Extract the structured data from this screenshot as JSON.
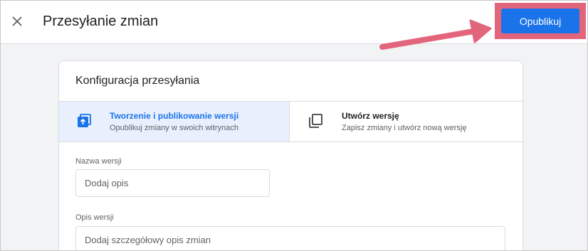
{
  "header": {
    "title": "Przesyłanie zmian",
    "publish_label": "Opublikuj",
    "close_icon": "close-icon"
  },
  "annotation": {
    "arrow_color": "#e3657c",
    "highlight_color": "#e3657c"
  },
  "card": {
    "title": "Konfiguracja przesyłania",
    "options": [
      {
        "title": "Tworzenie i publikowanie wersji",
        "subtitle": "Opublikuj zmiany w swoich witrynach",
        "icon": "publish-icon",
        "selected": true
      },
      {
        "title": "Utwórz wersję",
        "subtitle": "Zapisz zmiany i utwórz nową wersję",
        "icon": "copy-version-icon",
        "selected": false
      }
    ],
    "fields": {
      "version_name": {
        "label": "Nazwa wersji",
        "placeholder": "Dodaj opis",
        "value": ""
      },
      "version_description": {
        "label": "Opis wersji",
        "placeholder": "Dodaj szczegółowy opis zmian",
        "value": ""
      }
    }
  },
  "colors": {
    "accent": "#1a73e8",
    "selected_bg": "#e8f0fe"
  }
}
